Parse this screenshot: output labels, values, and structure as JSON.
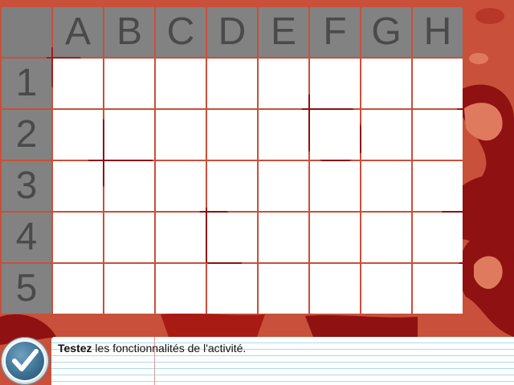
{
  "board": {
    "columns": [
      "A",
      "B",
      "C",
      "D",
      "E",
      "F",
      "G",
      "H"
    ],
    "rows": [
      "1",
      "2",
      "3",
      "4",
      "5"
    ]
  },
  "instruction": {
    "bold": "Testez",
    "rest": " les fonctionnalités de l'activité."
  },
  "colors": {
    "background": "#c9503a",
    "camouflage_dark": "#8f1111",
    "camouflage_light": "#e07a5f",
    "header_gray": "#828282",
    "header_text": "#4a4a4a",
    "cell": "#ffffff",
    "check_button": "#3d7394"
  },
  "icons": {
    "validate": "checkmark-icon"
  }
}
